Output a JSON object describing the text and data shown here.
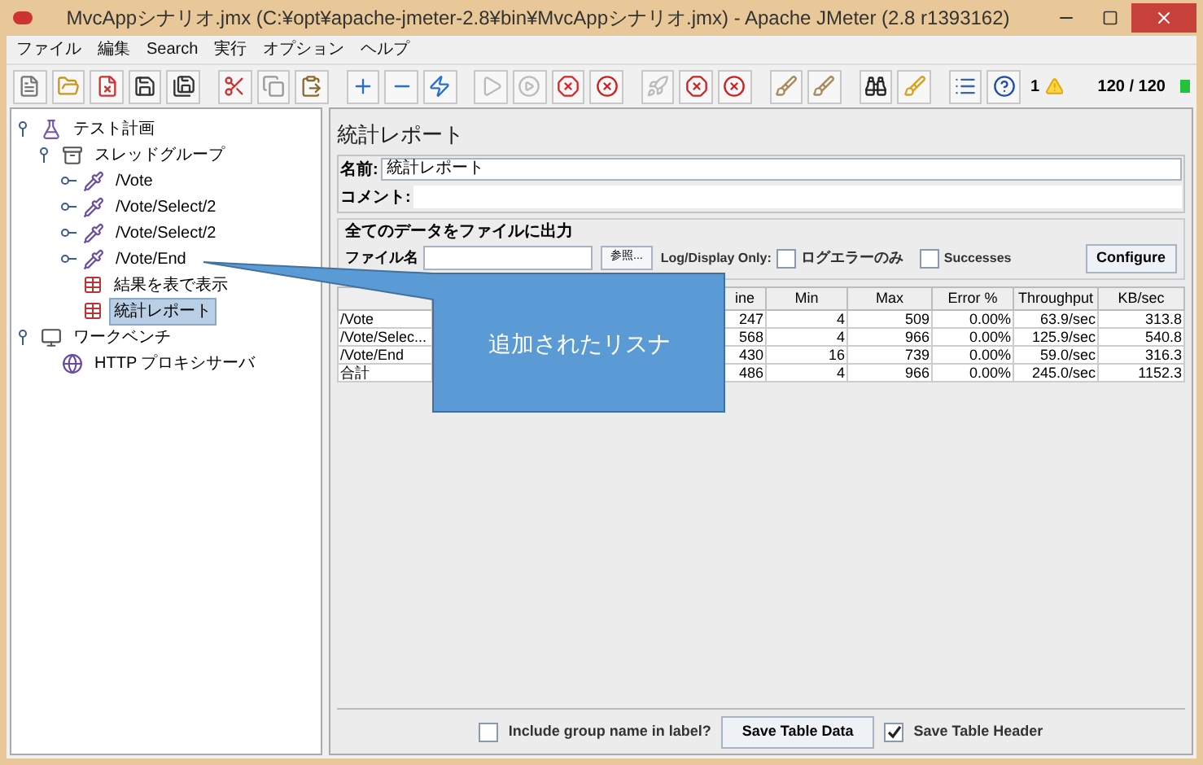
{
  "window": {
    "title": "MvcAppシナリオ.jmx (C:¥opt¥apache-jmeter-2.8¥bin¥MvcAppシナリオ.jmx) - Apache JMeter (2.8 r1393162)"
  },
  "menu": [
    "ファイル",
    "編集",
    "Search",
    "実行",
    "オプション",
    "ヘルプ"
  ],
  "toolbar_status": {
    "warnings": "1",
    "threads": "120 / 120"
  },
  "tree": [
    {
      "label": "テスト計画",
      "kind": "plan",
      "expanded": true,
      "selected": false,
      "children": [
        {
          "label": "スレッドグループ",
          "kind": "group",
          "expanded": true,
          "selected": false,
          "children": [
            {
              "label": "/Vote",
              "kind": "sampler",
              "expanded": false,
              "selected": false
            },
            {
              "label": "/Vote/Select/2",
              "kind": "sampler",
              "expanded": false,
              "selected": false
            },
            {
              "label": "/Vote/Select/2",
              "kind": "sampler",
              "expanded": false,
              "selected": false
            },
            {
              "label": "/Vote/End",
              "kind": "sampler",
              "expanded": false,
              "selected": false
            },
            {
              "label": "結果を表で表示",
              "kind": "listener",
              "selected": false
            },
            {
              "label": "統計レポート",
              "kind": "listener",
              "selected": true
            }
          ]
        }
      ]
    },
    {
      "label": "ワークベンチ",
      "kind": "workbench",
      "expanded": true,
      "selected": false,
      "children": [
        {
          "label": "HTTP プロキシサーバ",
          "kind": "proxy",
          "selected": false
        }
      ]
    }
  ],
  "panel": {
    "title": "統計レポート",
    "name_label": "名前:",
    "name_value": "統計レポート",
    "comment_label": "コメント:",
    "file_group": {
      "title": "全てのデータをファイルに出力",
      "file_label": "ファイル名",
      "browse_button": "参照...",
      "log_label": "Log/Display Only:",
      "errors_only": {
        "label": "ログエラーのみ",
        "checked": false
      },
      "successes": {
        "label": "Successes",
        "checked": false
      },
      "configure_button": "Configure"
    }
  },
  "table": {
    "columns": [
      "ine",
      "Min",
      "Max",
      "Error %",
      "Throughput",
      "KB/sec"
    ],
    "rows": [
      {
        "label": "/Vote",
        "cells": [
          "247",
          "4",
          "509",
          "0.00%",
          "63.9/sec",
          "313.8"
        ]
      },
      {
        "label": "/Vote/Selec...",
        "cells": [
          "568",
          "4",
          "966",
          "0.00%",
          "125.9/sec",
          "540.8"
        ]
      },
      {
        "label": "/Vote/End",
        "cells": [
          "430",
          "16",
          "739",
          "0.00%",
          "59.0/sec",
          "316.3"
        ]
      },
      {
        "label": "合計",
        "cells": [
          "486",
          "4",
          "966",
          "0.00%",
          "245.0/sec",
          "1152.3"
        ]
      }
    ]
  },
  "footer": {
    "include_group": {
      "label": "Include group name in label?",
      "checked": false
    },
    "save_data_button": "Save Table Data",
    "save_header": {
      "label": "Save Table Header",
      "checked": true
    }
  },
  "callout": {
    "text": "追加されたリスナ"
  }
}
